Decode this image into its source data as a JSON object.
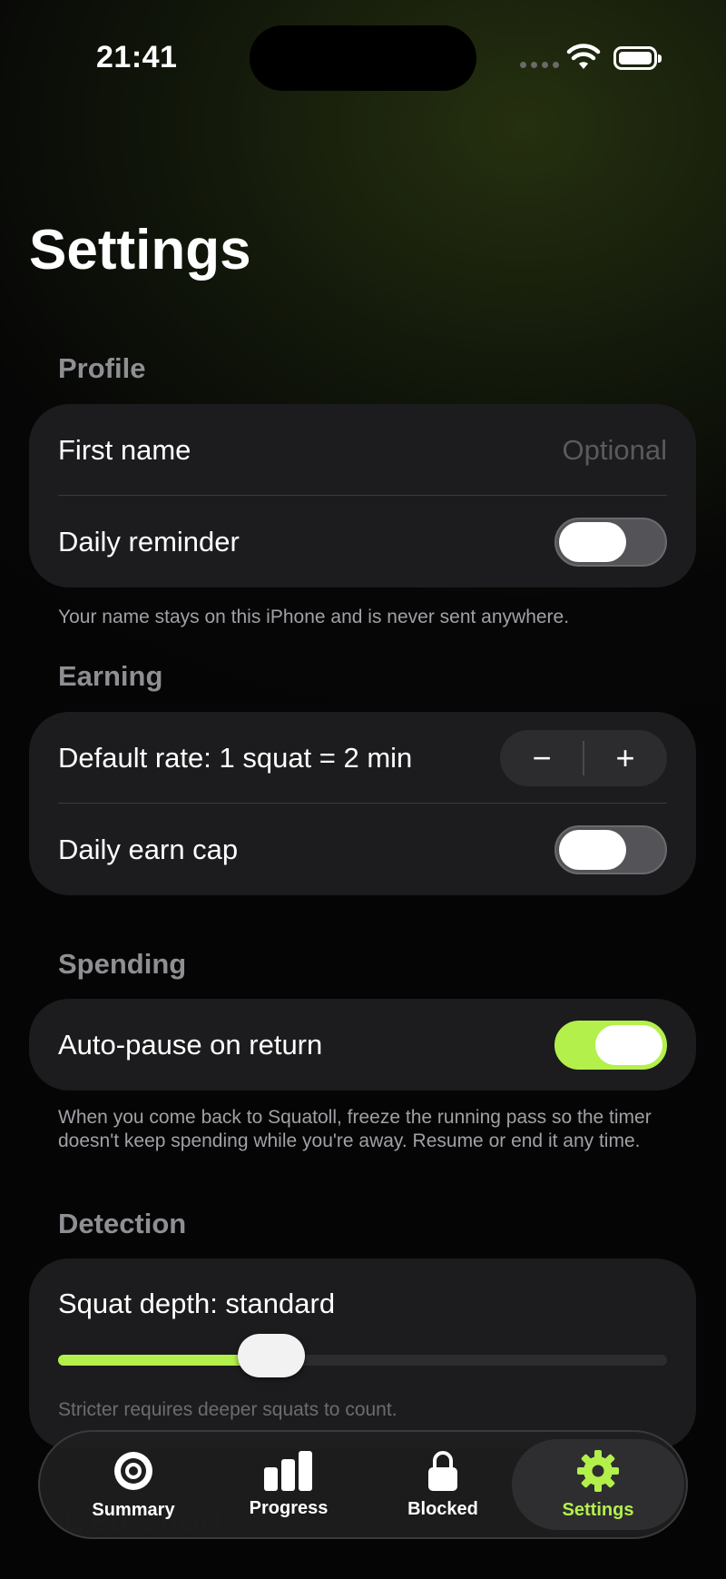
{
  "status_bar": {
    "time": "21:41"
  },
  "page": {
    "title": "Settings"
  },
  "profile": {
    "header": "Profile",
    "first_name_label": "First name",
    "first_name_placeholder": "Optional",
    "daily_reminder_label": "Daily reminder",
    "daily_reminder_on": false,
    "footer": "Your name stays on this iPhone and is never sent anywhere."
  },
  "earning": {
    "header": "Earning",
    "default_rate_label": "Default rate: 1 squat = 2 min",
    "stepper_minus": "−",
    "stepper_plus": "+",
    "daily_cap_label": "Daily earn cap",
    "daily_cap_on": false
  },
  "spending": {
    "header": "Spending",
    "auto_pause_label": "Auto-pause on return",
    "auto_pause_on": true,
    "footer": "When you come back to Squatoll, freeze the running pass so the timer doesn't keep spending while you're away. Resume or end it any time."
  },
  "detection": {
    "header": "Detection",
    "squat_depth_label": "Squat depth: standard",
    "squat_depth_level": 0.35,
    "caption": "Stricter requires deeper squats to count."
  },
  "tab_bar": {
    "tabs": [
      {
        "label": "Summary",
        "icon": "target-icon"
      },
      {
        "label": "Progress",
        "icon": "bar-chart-icon"
      },
      {
        "label": "Blocked",
        "icon": "lock-icon"
      },
      {
        "label": "Settings",
        "icon": "gear-icon"
      }
    ],
    "active": "Settings"
  },
  "colors": {
    "accent": "#b3f04b",
    "card": "#1c1c1e",
    "toggle_off": "#545458"
  }
}
